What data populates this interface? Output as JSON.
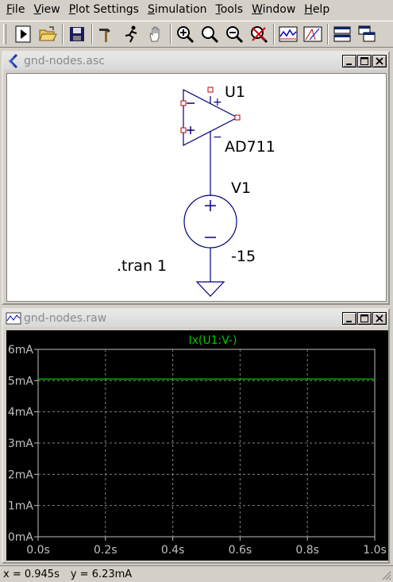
{
  "menu": [
    {
      "pre": "",
      "u": "F",
      "post": "ile"
    },
    {
      "pre": "",
      "u": "V",
      "post": "iew"
    },
    {
      "pre": "",
      "u": "P",
      "post": "lot Settings"
    },
    {
      "pre": "",
      "u": "S",
      "post": "imulation"
    },
    {
      "pre": "",
      "u": "T",
      "post": "ools"
    },
    {
      "pre": "",
      "u": "W",
      "post": "indow"
    },
    {
      "pre": "",
      "u": "H",
      "post": "elp"
    }
  ],
  "toolbar": {
    "icons": [
      "run-icon",
      "open-icon",
      "save-icon",
      "hammer-icon",
      "runner-icon",
      "pan-hand-icon",
      "zoom-in-icon",
      "zoom-out-icon",
      "zoom-full-icon",
      "zoom-cancel-icon",
      "waveform-icon",
      "autorange-icon",
      "tile-horizontal-icon",
      "cascade-icon"
    ]
  },
  "schematic": {
    "title": "gnd-nodes.asc",
    "opamp_ref": "U1",
    "opamp_model": "AD711",
    "source_ref": "V1",
    "source_value": "-15",
    "directive": ".tran 1",
    "plus_sign": "+",
    "minus_sign": "−"
  },
  "waveform": {
    "title": "gnd-nodes.raw",
    "trace_label": "Ix(U1:V-)",
    "trace_color": "#00c800",
    "axis_color": "#c0c0c0"
  },
  "chart_data": {
    "type": "line",
    "title": "",
    "xlabel": "",
    "ylabel": "",
    "x_ticks": [
      "0.0s",
      "0.2s",
      "0.4s",
      "0.6s",
      "0.8s",
      "1.0s"
    ],
    "y_ticks": [
      "0mA",
      "1mA",
      "2mA",
      "3mA",
      "4mA",
      "5mA",
      "6mA"
    ],
    "xlim": [
      0,
      1
    ],
    "ylim": [
      0,
      6
    ],
    "grid": true,
    "series": [
      {
        "name": "Ix(U1:V-)",
        "x": [
          0,
          1
        ],
        "y": [
          5.05,
          5.05
        ]
      }
    ]
  },
  "status": {
    "x": "x = 0.945s",
    "y": "y = 6.23mA"
  }
}
